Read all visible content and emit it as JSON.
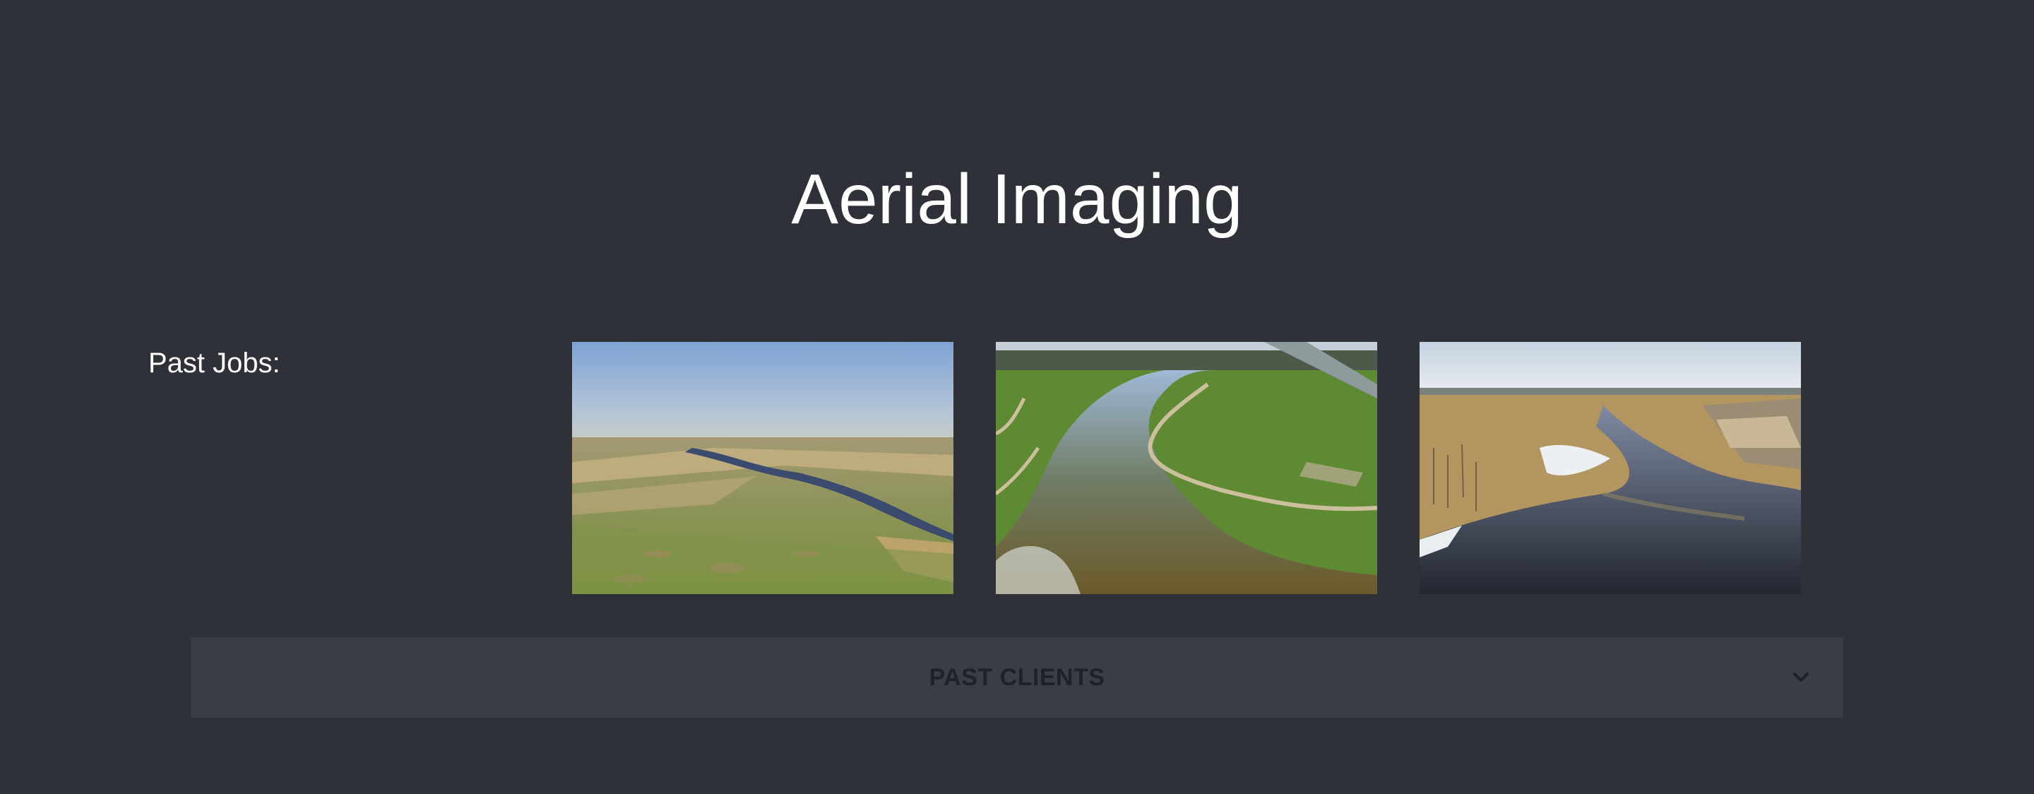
{
  "page": {
    "title": "Aerial Imaging",
    "background": "#2f3139"
  },
  "past_jobs": {
    "label": "Past Jobs:",
    "photos": [
      {
        "name": "prairie-river-aerial",
        "description_icon": "photo-icon"
      },
      {
        "name": "park-pond-aerial",
        "description_icon": "photo-icon"
      },
      {
        "name": "wetland-aerial",
        "description_icon": "photo-icon"
      }
    ]
  },
  "accordion": {
    "label": "PAST CLIENTS",
    "icon": "chevron-down-icon",
    "background": "#3b3d46",
    "text_color": "#1f2128"
  }
}
